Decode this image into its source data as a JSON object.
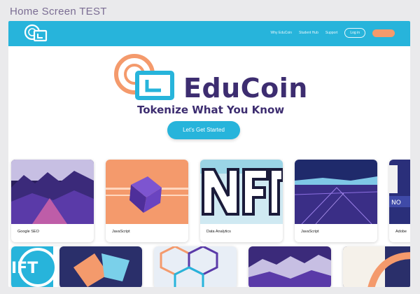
{
  "frame_title": "Home Screen TEST",
  "nav": {
    "links": [
      "Why EduCoin",
      "Student Hub",
      "Support"
    ],
    "login_label": "Log in"
  },
  "hero": {
    "brand": "EduCoin",
    "tagline": "Tokenize What You Know",
    "cta_label": "Let's Get Started"
  },
  "courses": [
    {
      "title": "Google SEO",
      "thumb": "purple-mountains"
    },
    {
      "title": "JavaScript",
      "thumb": "purple-cube"
    },
    {
      "title": "Data Analytics",
      "thumb": "nft-letters"
    },
    {
      "title": "JavaScript",
      "thumb": "dark-blue-landscape"
    },
    {
      "title": "Adobe",
      "thumb": "nft-no-letters"
    }
  ],
  "colors": {
    "nav": "#27b4db",
    "brand_text": "#3d2d70",
    "accent_orange": "#f49a6c",
    "background": "#eaeaec"
  }
}
